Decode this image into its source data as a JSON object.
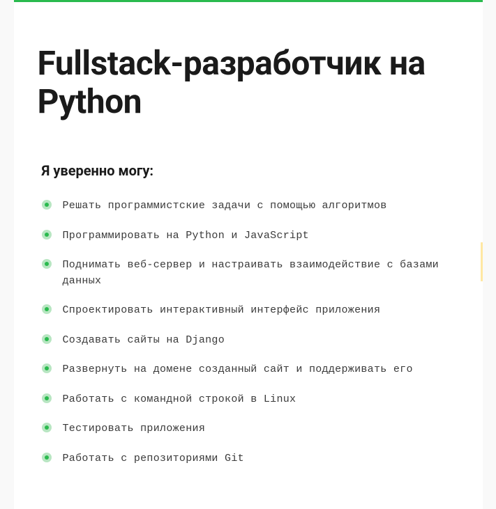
{
  "title": "Fullstack-разработчик на Python",
  "subtitle": "Я уверенно могу:",
  "skills": [
    "Решать программистские задачи с помощью алгоритмов",
    "Программировать на Python и JavaScript",
    "Поднимать веб-сервер и настраивать взаимодействие с базами данных",
    "Спроектировать интерактивный интерфейс приложения",
    "Создавать сайты на Django",
    "Развернуть на домене созданный сайт и поддерживать его",
    "Работать с командной строкой в Linux",
    "Тестировать приложения",
    "Работать с репозиториями Git"
  ]
}
